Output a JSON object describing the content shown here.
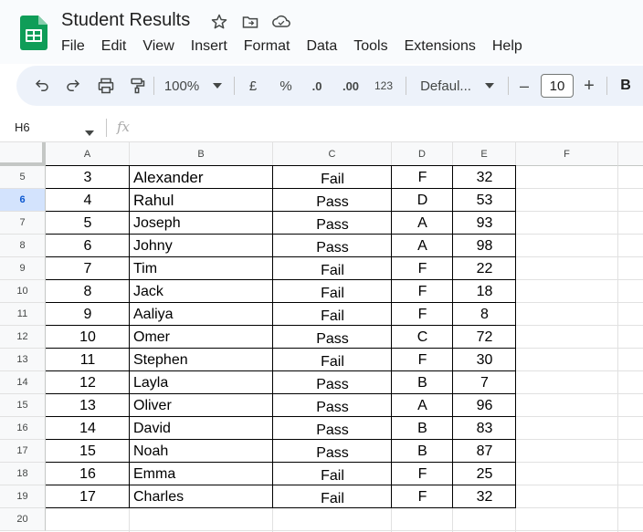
{
  "app": {
    "title": "Student Results",
    "menu": [
      "File",
      "Edit",
      "View",
      "Insert",
      "Format",
      "Data",
      "Tools",
      "Extensions",
      "Help"
    ]
  },
  "toolbar": {
    "zoom": "100%",
    "currency": "£",
    "percent": "%",
    "dec_decrease": ".0",
    "dec_increase": ".00",
    "number_format": "123",
    "font": "Defaul...",
    "font_size": "10",
    "minus": "–",
    "plus": "+",
    "bold": "B"
  },
  "formula_bar": {
    "name_box": "H6",
    "fx": "fx",
    "content": ""
  },
  "grid": {
    "columns": [
      "A",
      "B",
      "C",
      "D",
      "E",
      "F"
    ],
    "selected_row": "6",
    "rows": [
      {
        "num": "5",
        "cells": [
          "3",
          "Alexander",
          "Fail",
          "F",
          "32"
        ]
      },
      {
        "num": "6",
        "cells": [
          "4",
          "Rahul",
          "Pass",
          "D",
          "53"
        ]
      },
      {
        "num": "7",
        "cells": [
          "5",
          "Joseph",
          "Pass",
          "A",
          "93"
        ]
      },
      {
        "num": "8",
        "cells": [
          "6",
          "Johny",
          "Pass",
          "A",
          "98"
        ]
      },
      {
        "num": "9",
        "cells": [
          "7",
          "Tim",
          "Fail",
          "F",
          "22"
        ]
      },
      {
        "num": "10",
        "cells": [
          "8",
          "Jack",
          "Fail",
          "F",
          "18"
        ]
      },
      {
        "num": "11",
        "cells": [
          "9",
          "Aaliya",
          "Fail",
          "F",
          "8"
        ]
      },
      {
        "num": "12",
        "cells": [
          "10",
          "Omer",
          "Pass",
          "C",
          "72"
        ]
      },
      {
        "num": "13",
        "cells": [
          "11",
          "Stephen",
          "Fail",
          "F",
          "30"
        ]
      },
      {
        "num": "14",
        "cells": [
          "12",
          "Layla",
          "Pass",
          "B",
          "7"
        ]
      },
      {
        "num": "15",
        "cells": [
          "13",
          "Oliver",
          "Pass",
          "A",
          "96"
        ]
      },
      {
        "num": "16",
        "cells": [
          "14",
          "David",
          "Pass",
          "B",
          "83"
        ]
      },
      {
        "num": "17",
        "cells": [
          "15",
          "Noah",
          "Pass",
          "B",
          "87"
        ]
      },
      {
        "num": "18",
        "cells": [
          "16",
          "Emma",
          "Fail",
          "F",
          "25"
        ]
      },
      {
        "num": "19",
        "cells": [
          "17",
          "Charles",
          "Fail",
          "F",
          "32"
        ]
      },
      {
        "num": "20",
        "cells": [
          "",
          "",
          "",
          "",
          ""
        ]
      }
    ]
  },
  "colors": {
    "brand_green": "#0f9d58",
    "selection_blue": "#d3e3fd",
    "toolbar_bg": "#edf2fa"
  }
}
